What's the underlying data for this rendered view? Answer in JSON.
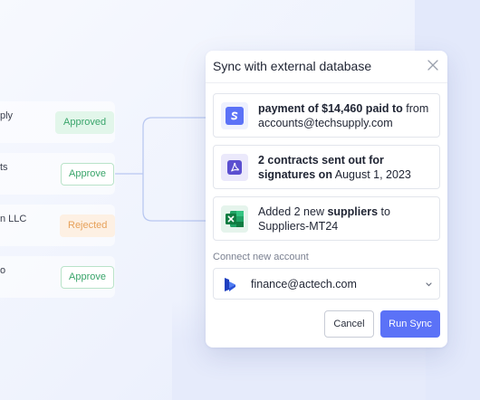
{
  "background_rows": [
    {
      "text": "ply",
      "status": "Approved",
      "status_type": "approved"
    },
    {
      "text": "ts",
      "status": "Approve",
      "status_type": "approve"
    },
    {
      "text": "n LLC",
      "status": "Rejected",
      "status_type": "rejected"
    },
    {
      "text": "o",
      "status": "Approve",
      "status_type": "approve"
    }
  ],
  "dialog": {
    "title": "Sync with external database",
    "items": [
      {
        "icon": "stripe-s-icon",
        "icon_color": "#5b72f7",
        "bold": "payment of $14,460 paid to",
        "rest_1": " from accounts@techsupply.com"
      },
      {
        "icon": "pdf-document-icon",
        "icon_color": "#5b4fd0",
        "bold": "2 contracts sent out for signatures on",
        "rest_1": " August 1, 2023"
      },
      {
        "icon": "excel-icon",
        "icon_color": "#1f8b4c",
        "pre": "Added 2 new ",
        "bold": "suppliers",
        "rest_1": " to Suppliers-MT24"
      }
    ],
    "connect_label": "Connect new account",
    "account": {
      "icon": "dynamics-logo-icon",
      "value": "finance@actech.com"
    },
    "cancel_label": "Cancel",
    "run_label": "Run Sync"
  },
  "colors": {
    "accent": "#5b72f7",
    "approved_bg": "#e2f6ea",
    "approved_text": "#3aa56b",
    "rejected_bg": "#fdf0e3",
    "rejected_text": "#e7a15a"
  }
}
